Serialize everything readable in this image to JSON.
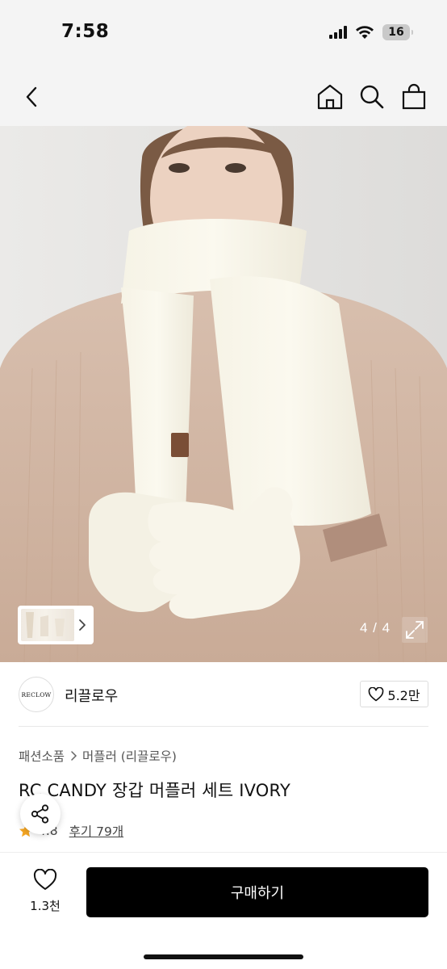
{
  "status_bar": {
    "time": "7:58",
    "battery": "16"
  },
  "nav": {
    "icons": [
      "back-icon",
      "home-icon",
      "search-icon",
      "shopping-bag-icon"
    ]
  },
  "gallery": {
    "page_indicator": "4 / 4"
  },
  "store": {
    "logo_text": "RECLOW",
    "name": "리끌로우",
    "likes": "5.2만"
  },
  "breadcrumb": {
    "category": "패션소품",
    "subcategory": "머플러 (리끌로우)"
  },
  "product": {
    "title": "RC CANDY 장갑 머플러 세트 IVORY",
    "rating": "4.8",
    "reviews": "후기 79개"
  },
  "bottom_bar": {
    "wish_count": "1.3천",
    "buy_label": "구매하기"
  },
  "colors": {
    "accent_star": "#f5a623",
    "button_bg": "#000000"
  }
}
